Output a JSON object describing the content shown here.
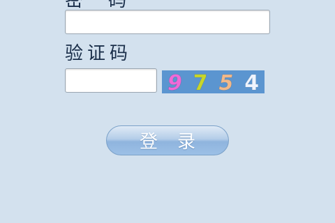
{
  "form": {
    "password_label": "密码",
    "password_value": "",
    "captcha_label": "验证码",
    "captcha_value": "",
    "captcha_code": [
      "9",
      "7",
      "5",
      "4"
    ],
    "captcha_colors": [
      "#f06ad8",
      "#c8d62a",
      "#f2b98a",
      "#eef4ff"
    ],
    "captcha_background": "#5b95d0",
    "login_label": "登录"
  },
  "theme": {
    "page_background": "#d3e1ee",
    "label_color": "#1b2f4a"
  }
}
